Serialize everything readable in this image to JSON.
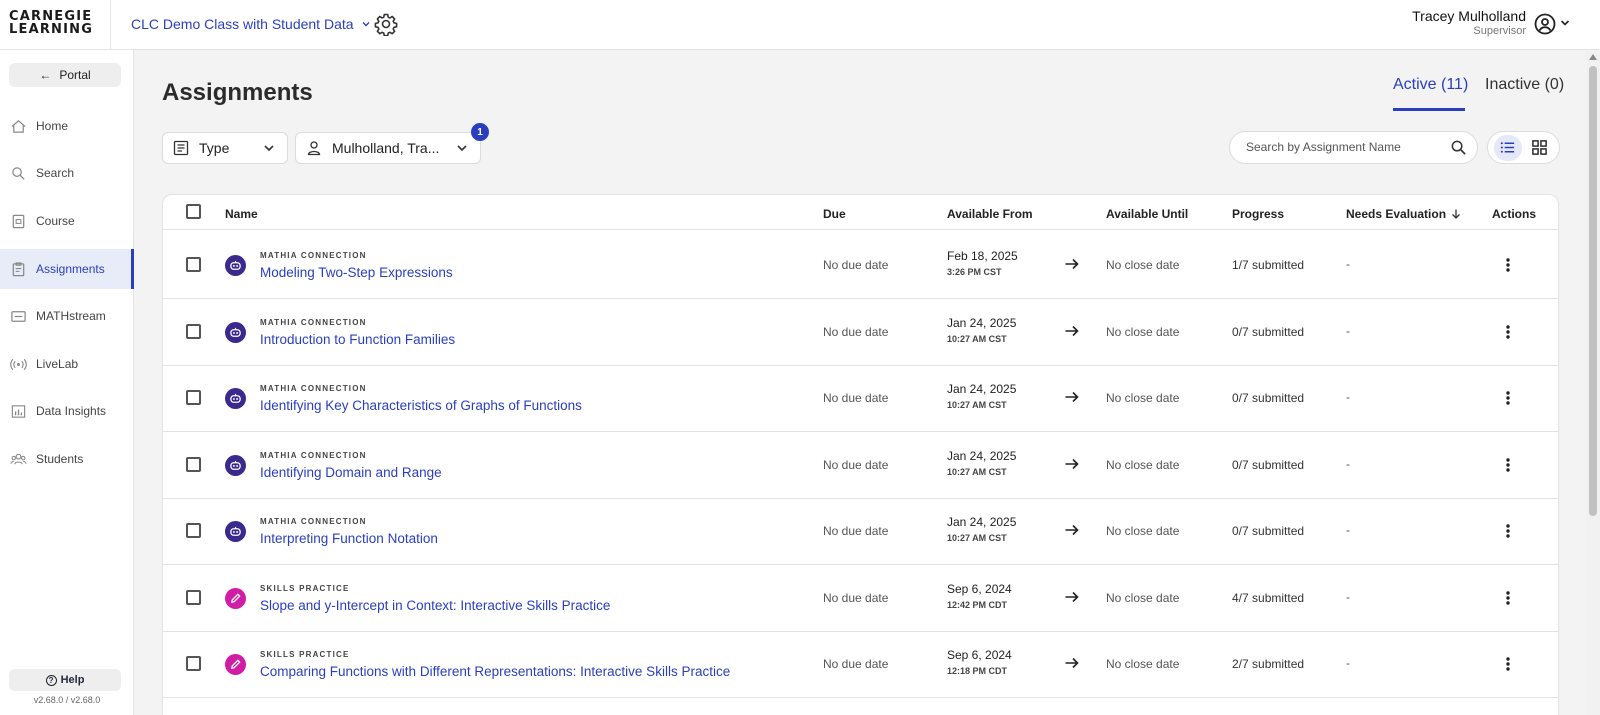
{
  "header": {
    "logo_line1": "CARNEGIE",
    "logo_line2": "LEARNING",
    "class_name": "CLC Demo Class with Student Data",
    "user_name": "Tracey Mulholland",
    "user_role": "Supervisor"
  },
  "sidebar": {
    "portal_label": "Portal",
    "items": [
      {
        "label": "Home",
        "icon": "home-icon"
      },
      {
        "label": "Search",
        "icon": "search-icon"
      },
      {
        "label": "Course",
        "icon": "course-icon"
      },
      {
        "label": "Assignments",
        "icon": "assignments-icon"
      },
      {
        "label": "MATHstream",
        "icon": "mathstream-icon"
      },
      {
        "label": "LiveLab",
        "icon": "livelab-icon"
      },
      {
        "label": "Data Insights",
        "icon": "data-insights-icon"
      },
      {
        "label": "Students",
        "icon": "students-icon"
      }
    ],
    "help_label": "Help",
    "version": "v2.68.0 / v2.68.0"
  },
  "main": {
    "title": "Assignments",
    "tabs": [
      {
        "label": "Active (11)"
      },
      {
        "label": "Inactive (0)"
      }
    ],
    "filters": {
      "type_label": "Type",
      "teacher_label": "Mulholland, Tra...",
      "teacher_badge": "1"
    },
    "search": {
      "placeholder": "Search by Assignment Name"
    },
    "table": {
      "headers": {
        "name": "Name",
        "due": "Due",
        "available_from": "Available From",
        "available_until": "Available Until",
        "progress": "Progress",
        "needs_evaluation": "Needs Evaluation",
        "actions": "Actions"
      },
      "rows": [
        {
          "type": "MATHIA CONNECTION",
          "kind": "mathia",
          "name": "Modeling Two-Step Expressions",
          "due": "No due date",
          "from_date": "Feb 18, 2025",
          "from_time": "3:26 PM CST",
          "until": "No close date",
          "progress": "1/7 submitted",
          "needs_eval": "-"
        },
        {
          "type": "MATHIA CONNECTION",
          "kind": "mathia",
          "name": "Introduction to Function Families",
          "due": "No due date",
          "from_date": "Jan 24, 2025",
          "from_time": "10:27 AM CST",
          "until": "No close date",
          "progress": "0/7 submitted",
          "needs_eval": "-"
        },
        {
          "type": "MATHIA CONNECTION",
          "kind": "mathia",
          "name": "Identifying Key Characteristics of Graphs of Functions",
          "due": "No due date",
          "from_date": "Jan 24, 2025",
          "from_time": "10:27 AM CST",
          "until": "No close date",
          "progress": "0/7 submitted",
          "needs_eval": "-"
        },
        {
          "type": "MATHIA CONNECTION",
          "kind": "mathia",
          "name": "Identifying Domain and Range",
          "due": "No due date",
          "from_date": "Jan 24, 2025",
          "from_time": "10:27 AM CST",
          "until": "No close date",
          "progress": "0/7 submitted",
          "needs_eval": "-"
        },
        {
          "type": "MATHIA CONNECTION",
          "kind": "mathia",
          "name": "Interpreting Function Notation",
          "due": "No due date",
          "from_date": "Jan 24, 2025",
          "from_time": "10:27 AM CST",
          "until": "No close date",
          "progress": "0/7 submitted",
          "needs_eval": "-"
        },
        {
          "type": "SKILLS PRACTICE",
          "kind": "skills",
          "name": "Slope and y-Intercept in Context: Interactive Skills Practice",
          "due": "No due date",
          "from_date": "Sep 6, 2024",
          "from_time": "12:42 PM CDT",
          "until": "No close date",
          "progress": "4/7 submitted",
          "needs_eval": "-"
        },
        {
          "type": "SKILLS PRACTICE",
          "kind": "skills",
          "name": "Comparing Functions with Different Representations: Interactive Skills Practice",
          "due": "No due date",
          "from_date": "Sep 6, 2024",
          "from_time": "12:18 PM CDT",
          "until": "No close date",
          "progress": "2/7 submitted",
          "needs_eval": "-"
        }
      ]
    }
  },
  "colors": {
    "accent": "#2a3fbf",
    "mathia_icon": "#3b2a8c",
    "skills_icon": "#d11ca6"
  }
}
